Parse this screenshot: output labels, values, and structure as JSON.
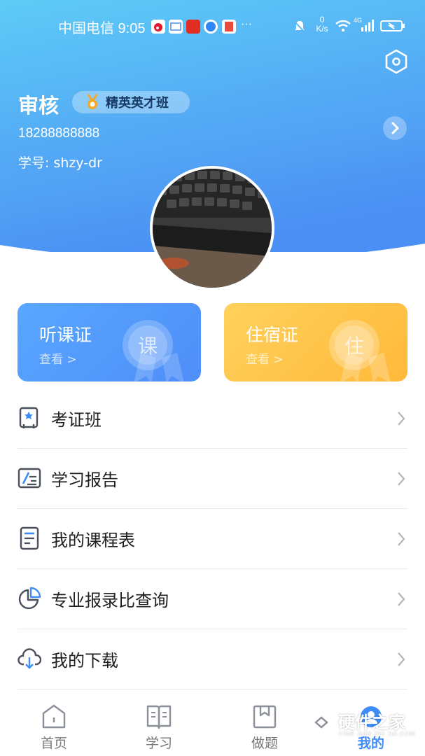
{
  "status_bar": {
    "carrier_time": "中国电信 9:05",
    "more": "···",
    "net_speed_value": "0",
    "net_speed_unit": "K/s",
    "signal_label": "4G",
    "icons": [
      "weibo-app-icon",
      "mail-app-icon",
      "pinduoduo-app-icon",
      "browser-app-icon",
      "book-app-icon",
      "mute-bell-icon",
      "wifi-icon",
      "signal-icon",
      "battery-charging-icon"
    ]
  },
  "profile": {
    "name": "审核",
    "class_badge": "精英英才班",
    "phone": "18288888888",
    "student_id": "学号: shzy-dr"
  },
  "cards": [
    {
      "title": "听课证",
      "sub": "查看 >",
      "emblem": "课",
      "color": "#5299fb"
    },
    {
      "title": "住宿证",
      "sub": "查看 >",
      "emblem": "住",
      "color": "#ffc546"
    }
  ],
  "menu": [
    {
      "label": "考证班",
      "icon": "certificate-class-icon"
    },
    {
      "label": "学习报告",
      "icon": "study-report-icon"
    },
    {
      "label": "我的课程表",
      "icon": "schedule-icon"
    },
    {
      "label": "专业报录比查询",
      "icon": "pie-chart-icon"
    },
    {
      "label": "我的下载",
      "icon": "cloud-download-icon"
    }
  ],
  "tabs": [
    {
      "label": "首页",
      "icon": "home-icon",
      "active": false
    },
    {
      "label": "学习",
      "icon": "study-book-icon",
      "active": false
    },
    {
      "label": "做题",
      "icon": "exercise-icon",
      "active": false
    },
    {
      "label": "我的",
      "icon": "profile-icon",
      "active": true
    }
  ],
  "watermark": {
    "text": "硬件之家",
    "sub": "YING JIAN ZHI JIA.COM"
  },
  "colors": {
    "accent": "#3d8cf7",
    "header_top": "#5fc8f5",
    "header_bottom": "#4d93f3"
  }
}
